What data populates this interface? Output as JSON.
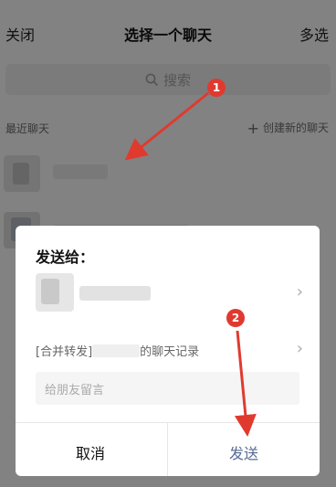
{
  "header": {
    "close_label": "关闭",
    "title": "选择一个聊天",
    "multi_select_label": "多选"
  },
  "search": {
    "placeholder": "搜索"
  },
  "recent": {
    "section_title": "最近聊天",
    "create_new_label": "创建新的聊天"
  },
  "dialog": {
    "title": "发送给：",
    "forward_prefix": "[合并转发]",
    "forward_suffix": "的聊天记录",
    "message_placeholder": "给朋友留言",
    "cancel_label": "取消",
    "send_label": "发送"
  },
  "annotations": {
    "marker_1": "1",
    "marker_2": "2"
  },
  "colors": {
    "send": "#576b95",
    "marker": "#e03a2f"
  }
}
